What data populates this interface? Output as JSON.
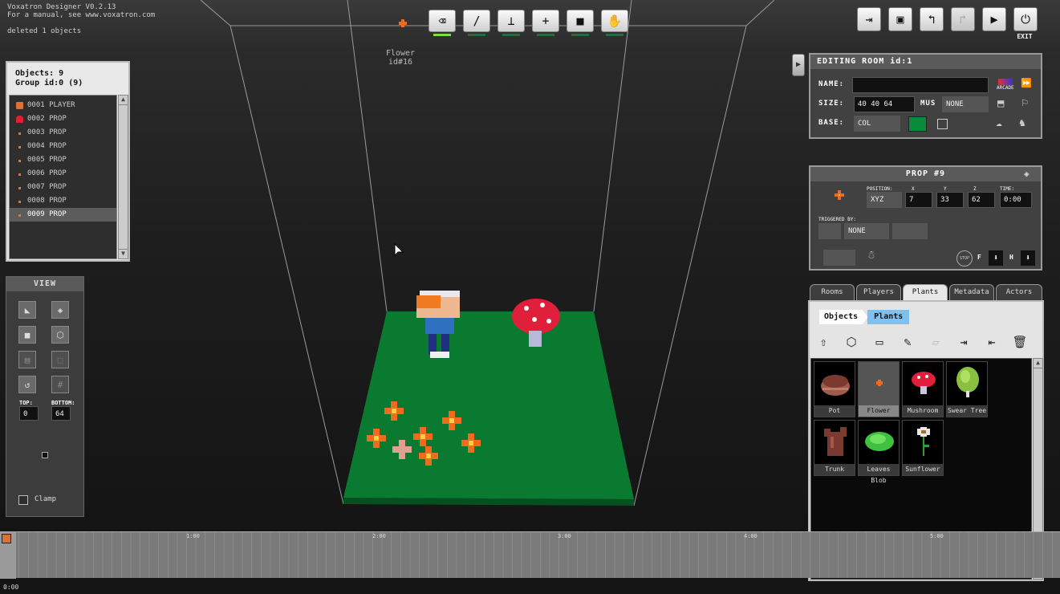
{
  "app": {
    "title": "Voxatron Designer V0.2.13",
    "manual": "For a manual, see www.voxatron.com",
    "status": "deleted 1 objects"
  },
  "toolbar": {
    "tools": [
      {
        "name": "eraser-tool",
        "glyph": "⌫",
        "active": true
      },
      {
        "name": "brush-tool",
        "glyph": "/",
        "active": false
      },
      {
        "name": "stamp-tool",
        "glyph": "⊥",
        "active": false
      },
      {
        "name": "add-tool",
        "glyph": "+",
        "active": false
      },
      {
        "name": "camera-tool",
        "glyph": "■",
        "active": false
      },
      {
        "name": "hand-tool",
        "glyph": "✋",
        "active": false
      }
    ],
    "exit_label": "EXIT"
  },
  "viewport": {
    "hover_name": "Flower",
    "hover_id": "id#16"
  },
  "objects_panel": {
    "count_label": "Objects: 9",
    "group_label": "Group id:0 (9)",
    "items": [
      {
        "label": "0001 PLAYER",
        "icon": "player-icon",
        "color": "#e07030"
      },
      {
        "label": "0002 PROP",
        "icon": "mushroom-icon",
        "color": "#e02030"
      },
      {
        "label": "0003 PROP",
        "icon": "flower-icon",
        "color": "#f07020"
      },
      {
        "label": "0004 PROP",
        "icon": "flower-icon",
        "color": "#f07020"
      },
      {
        "label": "0005 PROP",
        "icon": "flower-icon",
        "color": "#f07020"
      },
      {
        "label": "0006 PROP",
        "icon": "flower-icon",
        "color": "#f07020"
      },
      {
        "label": "0007 PROP",
        "icon": "flower-icon",
        "color": "#f07020"
      },
      {
        "label": "0008 PROP",
        "icon": "flower-icon",
        "color": "#f07020"
      },
      {
        "label": "0009 PROP",
        "icon": "flower-icon",
        "color": "#f07020",
        "selected": true
      }
    ]
  },
  "view_panel": {
    "title": "VIEW",
    "top_label": "TOP:",
    "bottom_label": "BOTTOM:",
    "top_value": "0",
    "bottom_value": "64",
    "clamp_label": "Clamp"
  },
  "room_panel": {
    "title": "EDITING ROOM id:1",
    "name_label": "NAME:",
    "name_value": "",
    "size_label": "SIZE:",
    "size_value": "40 40 64",
    "mus_label": "MUS",
    "mus_value": "NONE",
    "base_label": "BASE:",
    "base_value": "COL",
    "base_color": "#0a8a3a",
    "arcade_label": "ARCADE"
  },
  "prop_panel": {
    "title": "PROP #9",
    "position_label": "POSITION:",
    "x_label": "X",
    "y_label": "Y",
    "z_label": "Z",
    "time_label": "TIME:",
    "position_mode": "XYZ",
    "x": "7",
    "y": "33",
    "z": "62",
    "time": "0:00",
    "triggered_label": "TRIGGERED BY:",
    "triggered_value": "NONE",
    "stop_label": "STOP",
    "f_label": "F",
    "h_label": "H"
  },
  "library": {
    "tabs": [
      "Rooms",
      "Players",
      "Plants",
      "Metadata",
      "Actors"
    ],
    "active_tab": "Plants",
    "breadcrumb": [
      "Objects",
      "Plants"
    ],
    "items": [
      {
        "label": "Pot",
        "icon": "pot-icon"
      },
      {
        "label": "Flower",
        "icon": "flower-icon",
        "selected": true
      },
      {
        "label": "Mushroom",
        "icon": "mushroom-icon"
      },
      {
        "label": "Swear Tree",
        "icon": "tree-icon"
      },
      {
        "label": "Trunk",
        "icon": "trunk-icon"
      },
      {
        "label": "Leaves Blob",
        "icon": "leaves-icon"
      },
      {
        "label": "Sunflower",
        "icon": "sunflower-icon"
      }
    ]
  },
  "timeline": {
    "ticks": [
      "1:00",
      "2:00",
      "3:00",
      "4:00",
      "5:00"
    ],
    "current_time": "0:00"
  }
}
